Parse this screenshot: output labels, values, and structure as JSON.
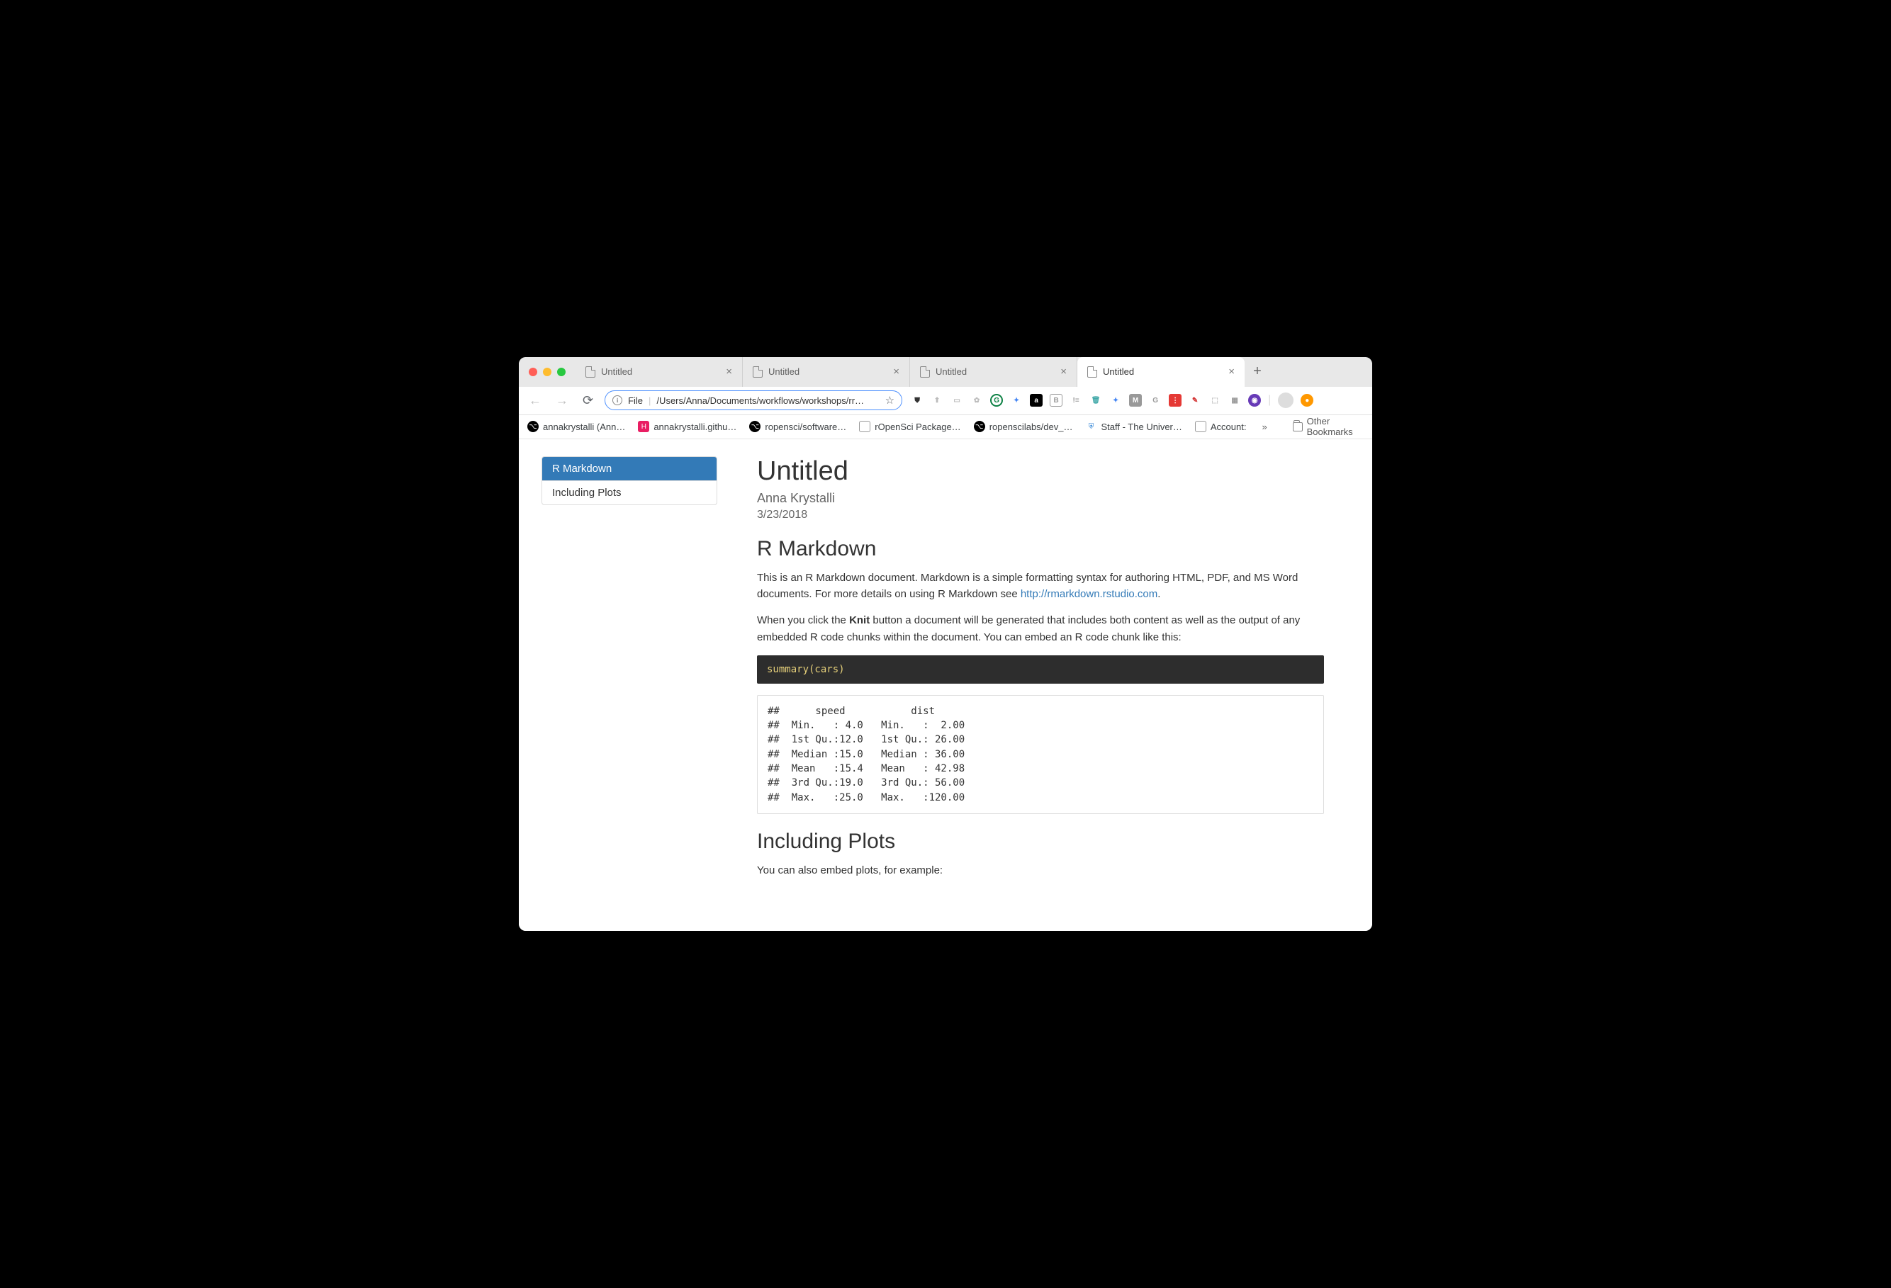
{
  "tabs": [
    {
      "label": "Untitled",
      "active": false
    },
    {
      "label": "Untitled",
      "active": false
    },
    {
      "label": "Untitled",
      "active": false
    },
    {
      "label": "Untitled",
      "active": true
    }
  ],
  "address": {
    "scheme": "File",
    "path": "/Users/Anna/Documents/workflows/workshops/rr…"
  },
  "bookmarks": [
    {
      "label": "annakrystalli (Ann…"
    },
    {
      "label": "annakrystalli.githu…"
    },
    {
      "label": "ropensci/software…"
    },
    {
      "label": "rOpenSci Package…"
    },
    {
      "label": "ropenscilabs/dev_…"
    },
    {
      "label": "Staff - The Univer…"
    },
    {
      "label": "Account:"
    }
  ],
  "bookmarks_more": "»",
  "other_bookmarks": "Other Bookmarks",
  "toc": [
    {
      "label": "R Markdown",
      "active": true
    },
    {
      "label": "Including Plots",
      "active": false
    }
  ],
  "doc": {
    "title": "Untitled",
    "author": "Anna Krystalli",
    "date": "3/23/2018",
    "section1_title": "R Markdown",
    "para1_a": "This is an R Markdown document. Markdown is a simple formatting syntax for authoring HTML, PDF, and MS Word documents. For more details on using R Markdown see ",
    "para1_link": "http://rmarkdown.rstudio.com",
    "para1_b": ".",
    "para2_a": "When you click the ",
    "para2_strong": "Knit",
    "para2_b": " button a document will be generated that includes both content as well as the output of any embedded R code chunks within the document. You can embed an R code chunk like this:",
    "code1": "summary(cars)",
    "output1": "##      speed           dist       \n##  Min.   : 4.0   Min.   :  2.00  \n##  1st Qu.:12.0   1st Qu.: 26.00  \n##  Median :15.0   Median : 36.00  \n##  Mean   :15.4   Mean   : 42.98  \n##  3rd Qu.:19.0   3rd Qu.: 56.00  \n##  Max.   :25.0   Max.   :120.00",
    "section2_title": "Including Plots",
    "para3": "You can also embed plots, for example:"
  }
}
